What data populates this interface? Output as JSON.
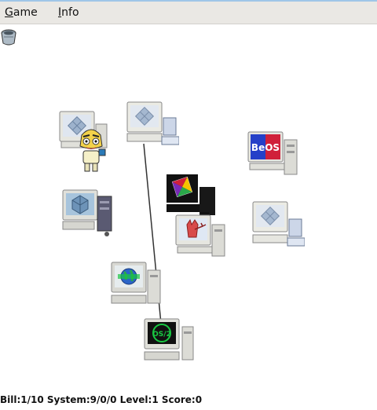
{
  "menu": {
    "game": {
      "mnemonic": "G",
      "rest": "ame"
    },
    "info": {
      "mnemonic": "I",
      "rest": "nfo"
    }
  },
  "status_text": "Bill:1/10  System:9/0/0  Level:1  Score:0",
  "computers": [
    {
      "os": "bsd-daemon",
      "label": ""
    },
    {
      "os": "sun-solaris",
      "label": ""
    },
    {
      "os": "beos",
      "label": "BeOS"
    },
    {
      "os": "next",
      "label": ""
    },
    {
      "os": "wingdows",
      "label": ""
    },
    {
      "os": "sun-solaris",
      "label": ""
    },
    {
      "os": "bsd-daemon",
      "label": ""
    },
    {
      "os": "globe",
      "label": ""
    },
    {
      "os": "os2",
      "label": "OS/2"
    }
  ],
  "colors": {
    "menubar_bg": "#eae8e4",
    "top_line": "#9fc6e8",
    "beos_blue": "#2540c8",
    "beos_red": "#d0203a",
    "os2_green": "#19c842",
    "wire": "#333333"
  },
  "icons": [
    "toolbox-icon",
    "bill-character-icon",
    "network-cable"
  ]
}
